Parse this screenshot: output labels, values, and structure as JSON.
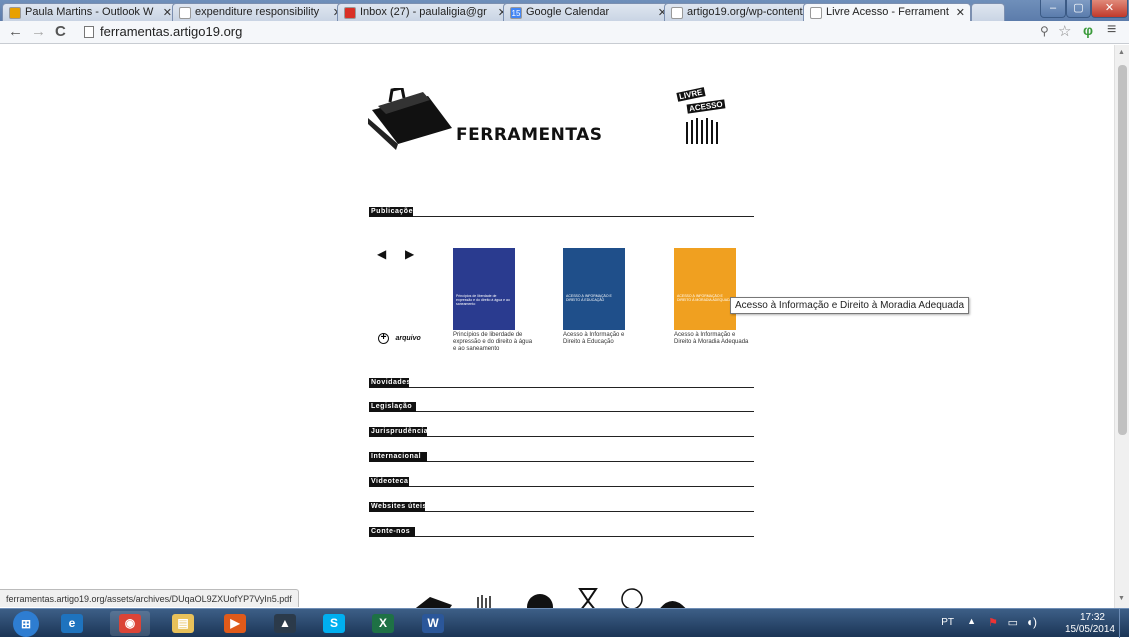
{
  "browser": {
    "tabs": [
      {
        "label": "Paula Martins - Outlook W",
        "icon_color": "#e8a000"
      },
      {
        "label": "expenditure responsibility",
        "icon_color": "#ffffff"
      },
      {
        "label": "Inbox (27) - paulaligia@gr",
        "icon_color": "#d93025"
      },
      {
        "label": "Google Calendar",
        "icon_color": "#4285f4",
        "icon_text": "15"
      },
      {
        "label": "artigo19.org/wp-content/",
        "icon_color": "#ffffff"
      },
      {
        "label": "Livre Acesso - Ferrament",
        "icon_color": "#ffffff"
      }
    ],
    "url": "ferramentas.artigo19.org",
    "status_url": "ferramentas.artigo19.org/assets/archives/DUqaOL9ZXUofYP7VyIn5.pdf"
  },
  "site": {
    "title": "FERRAMENTAS",
    "logo_right": {
      "top": "LIVRE",
      "bottom": "ACESSO"
    },
    "sections": [
      {
        "label": "Publicações"
      },
      {
        "label": "Novidades"
      },
      {
        "label": "Legislação"
      },
      {
        "label": "Jurisprudência"
      },
      {
        "label": "Internacional"
      },
      {
        "label": "Videoteca"
      },
      {
        "label": "Websites úteis"
      },
      {
        "label": "Conte-nos"
      }
    ],
    "archive_label": "arquivo",
    "books": [
      {
        "caption": "Princípios de liberdade de expressão e do direito à água e ao saneamento",
        "cover_color": "#2a3b8f",
        "cover_text": "Princípios de liberdade de expressão e do direito à água e ao saneamento"
      },
      {
        "caption": "Acesso à Informação e Direito à Educação",
        "cover_color": "#1f4f8a",
        "cover_text": "ACESSO À INFORMAÇÃO E DIREITO À EDUCAÇÃO"
      },
      {
        "caption": "Acesso à Informação e Direito à Moradia Adequada",
        "cover_color": "#f0a020",
        "cover_text": "ACESSO À INFORMAÇÃO E DIREITO À MORADIA ADEQUADA"
      }
    ],
    "tooltip": "Acesso à Informação e Direito à Moradia Adequada"
  },
  "taskbar": {
    "apps": [
      {
        "name": "start-button",
        "color": "#2e7dd1",
        "glyph": "⊞"
      },
      {
        "name": "ie",
        "color": "#1e73be",
        "glyph": "e"
      },
      {
        "name": "chrome",
        "color": "#db4437",
        "glyph": "◉"
      },
      {
        "name": "explorer",
        "color": "#e8c15a",
        "glyph": "▤"
      },
      {
        "name": "media",
        "color": "#e05a1a",
        "glyph": "▶"
      },
      {
        "name": "app6",
        "color": "#2b3a4a",
        "glyph": "▲"
      },
      {
        "name": "skype",
        "color": "#00aff0",
        "glyph": "S"
      },
      {
        "name": "excel",
        "color": "#1e7145",
        "glyph": "X"
      },
      {
        "name": "word",
        "color": "#2b579a",
        "glyph": "W"
      }
    ],
    "lang": "PT",
    "time": "17:32",
    "date": "15/05/2014"
  }
}
